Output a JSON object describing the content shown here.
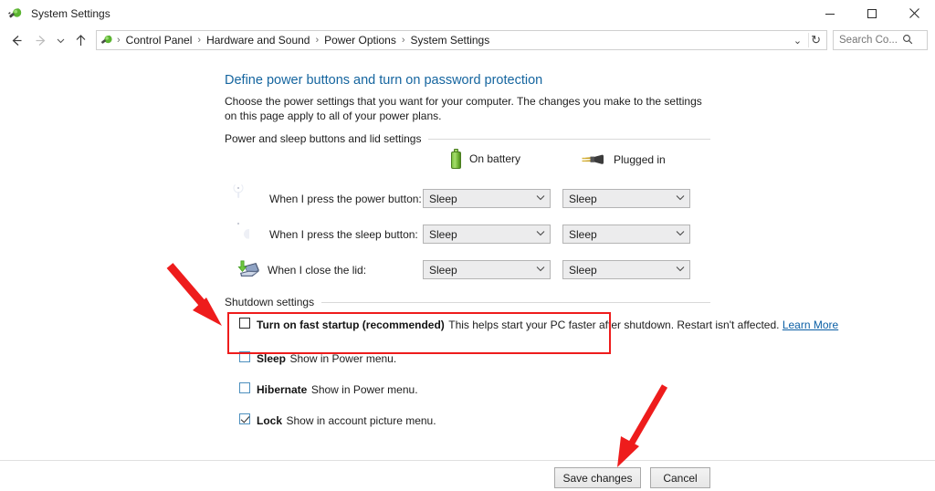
{
  "window": {
    "title": "System Settings",
    "icon": "power-plug-icon",
    "controls": {
      "minimize": "minimize-icon",
      "maximize": "maximize-icon",
      "close": "close-icon"
    }
  },
  "addressbar": {
    "back": "back-arrow-icon",
    "forward": "forward-arrow-icon",
    "history": "chevron-down-icon",
    "up": "up-arrow-icon",
    "breadcrumbs": [
      "Control Panel",
      "Hardware and Sound",
      "Power Options",
      "System Settings"
    ],
    "separator": "›",
    "dropdown": "⌄",
    "refresh": "↻",
    "search": {
      "placeholder": "Search Co...",
      "value": "",
      "icon": "search-icon"
    }
  },
  "page": {
    "title": "Define power buttons and turn on password protection",
    "description": "Choose the power settings that you want for your computer. The changes you make to the settings on this page apply to all of your power plans."
  },
  "sections": {
    "power_lid": "Power and sleep buttons and lid settings",
    "shutdown": "Shutdown settings"
  },
  "columns": [
    {
      "label": "On battery",
      "icon": "battery-icon"
    },
    {
      "label": "Plugged in",
      "icon": "power-plug-icon"
    }
  ],
  "settings_rows": [
    {
      "label": "When I press the power button:",
      "icon": "power-button-icon",
      "on_battery": "Sleep",
      "plugged_in": "Sleep"
    },
    {
      "label": "When I press the sleep button:",
      "icon": "sleep-button-icon",
      "on_battery": "Sleep",
      "plugged_in": "Sleep"
    },
    {
      "label": "When I close the lid:",
      "icon": "laptop-lid-icon",
      "on_battery": "Sleep",
      "plugged_in": "Sleep"
    }
  ],
  "shutdown_options": [
    {
      "title": "Turn on fast startup (recommended)",
      "subtitle": "This helps start your PC faster after shutdown. Restart isn't affected.",
      "link": "Learn More",
      "checked": false,
      "highlighted": true
    },
    {
      "title": "Sleep",
      "subtitle": "Show in Power menu.",
      "link": "",
      "checked": false,
      "highlighted": false
    },
    {
      "title": "Hibernate",
      "subtitle": "Show in Power menu.",
      "link": "",
      "checked": false,
      "highlighted": false
    },
    {
      "title": "Lock",
      "subtitle": "Show in account picture menu.",
      "link": "",
      "checked": true,
      "highlighted": false
    }
  ],
  "footer": {
    "save_label": "Save changes",
    "cancel_label": "Cancel"
  },
  "annotations": {
    "arrow_color": "#ee1c1c",
    "highlight_color": "#ee1c1c",
    "arrows": [
      {
        "name": "arrow-to-fast-startup",
        "points_to": "Turn on fast startup (recommended)"
      },
      {
        "name": "arrow-to-save-changes",
        "points_to": "Save changes"
      }
    ]
  },
  "colors": {
    "link": "#0b5fa5",
    "title": "#15659f",
    "accent_red": "#ee1c1c",
    "battery_green": "#7bc142"
  }
}
